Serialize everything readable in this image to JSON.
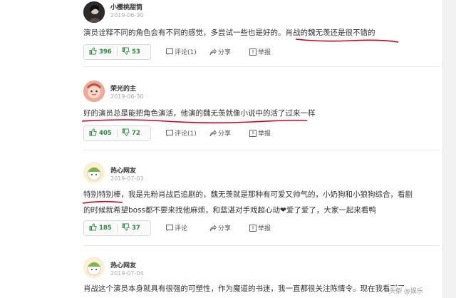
{
  "comments": [
    {
      "name": "小樱桃甜筒",
      "date": "2019-06-30",
      "text_a": "演员诠释不同的角色会有不同的感觉，多尝试一些也是好的。",
      "text_b": "肖战的魏无羡还是很不错的",
      "up": "396",
      "down": "53",
      "reply_label": "评论(1)",
      "share_label": "分享",
      "report_label": "举报"
    },
    {
      "name": "荣光的主",
      "date": "2019-06-30",
      "text": "好的演员总是能把角色演活，他演的魏无羡就像小说中的活了过来一样",
      "up": "405",
      "down": "72",
      "reply_label": "评论(1)",
      "share_label": "分享",
      "report_label": "举报"
    },
    {
      "name": "热心网友",
      "date": "2019-07-03",
      "text_line1": "特别特别棒，我是先粉肖战后追剧的，魏无羡就是那种有可爱又帅气的，小奶狗和小狼狗综合，看剧",
      "text_line2": "的时候就希望boss都不要来找他麻烦，和蓝湛对手戏超心动❤爱了爱了，大家一起来看鸭",
      "up": "185",
      "down": "37",
      "reply_label": "评论",
      "share_label": "分享",
      "report_label": "举报"
    },
    {
      "name": "热心网友",
      "date": "2019-07-04",
      "text": "肖战这个演员本身就具有很强的可塑性，作为魔道的书迷，我一直都很关注陈情令。现在我看到了",
      "watermark": "头条 @娱乐"
    }
  ],
  "colors": {
    "underline": "#d0021b",
    "vote_green": "#2b8a3e"
  }
}
